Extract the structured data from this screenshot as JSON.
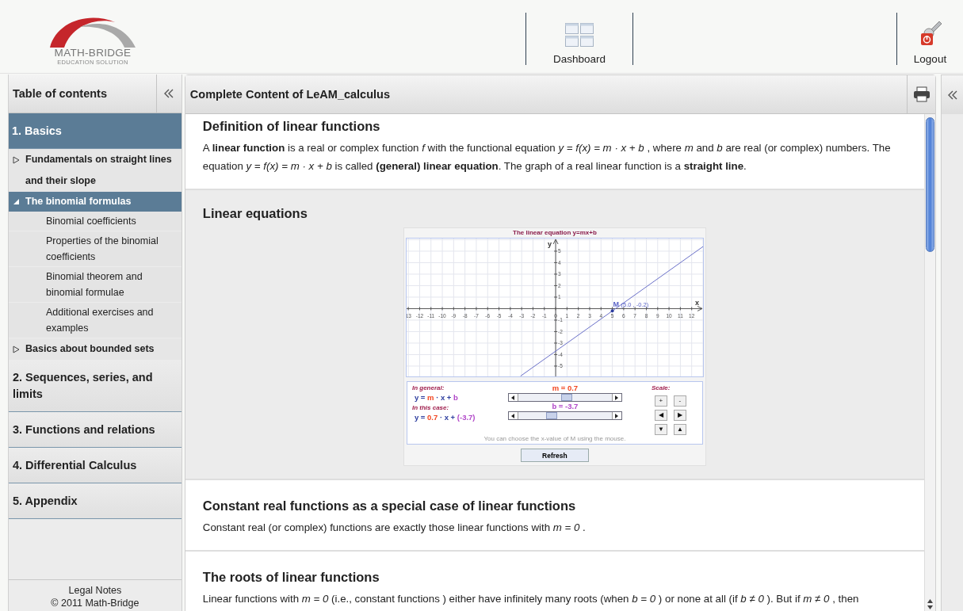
{
  "header": {
    "logo": {
      "name": "MATH-BRIDGE",
      "tagline": "EDUCATION SOLUTION"
    },
    "nav": [
      {
        "label": "Dashboard",
        "kind": "dashboard"
      },
      {
        "label": "Logout",
        "kind": "logout"
      }
    ]
  },
  "sidebar": {
    "title": "Table of contents",
    "toc": [
      {
        "label": "1. Basics",
        "selected": true,
        "children": [
          {
            "label": "Fundamentals on straight lines and their slope",
            "expanded": false,
            "selected": false
          },
          {
            "label": "The binomial formulas",
            "expanded": true,
            "selected": true,
            "children": [
              {
                "label": "Binomial coefficients",
                "selected": false
              },
              {
                "label": "Properties of the binomial coefficients",
                "selected": false
              },
              {
                "label": "Binomial theorem and binomial formulae",
                "selected": false
              },
              {
                "label": "Additional exercises and examples",
                "selected": false
              }
            ]
          },
          {
            "label": "Basics about bounded sets",
            "expanded": false,
            "selected": false
          }
        ]
      },
      {
        "label": "2. Sequences, series, and limits",
        "selected": false
      },
      {
        "label": "3. Functions and relations",
        "selected": false
      },
      {
        "label": "4. Differential Calculus",
        "selected": false
      },
      {
        "label": "5. Appendix",
        "selected": false
      }
    ],
    "footer": [
      "Legal Notes",
      "© 2011 Math-Bridge"
    ]
  },
  "main": {
    "title": "Complete Content of LeAM_calculus",
    "sections": [
      {
        "kind": "text",
        "title": "Definition of linear functions",
        "body": "A **linear function** is a real or complex function *f* with the functional equation *y = f(x) = m · x + b* , where *m* and *b* are real (or complex) numbers. The equation *y = f(x) = m · x + b* is called **(general) linear equation**. The graph of a real linear function is a **straight line**."
      },
      {
        "kind": "applet",
        "title": "Linear equations",
        "chart_data": {
          "type": "line",
          "title": "The linear equation y=mx+b",
          "xlabel": "x",
          "ylabel": "y",
          "x": [
            -3.1,
            13
          ],
          "series": [
            {
              "color": "#6a70c8",
              "values": [
                -5.87,
                5.4
              ]
            }
          ],
          "xlim": [
            -13.15,
            13
          ],
          "ylim": [
            -5.9,
            6.1
          ],
          "xticks": [
            {
              "value": -13,
              "label": "13"
            },
            -12,
            -11,
            -10,
            -9,
            -8,
            -7,
            -6,
            -5,
            -4,
            -3,
            -2,
            -1,
            0,
            1,
            2,
            3,
            4,
            5,
            6,
            7,
            8,
            9,
            10,
            11,
            12
          ],
          "yticks": [
            -5,
            -4,
            -3,
            -2,
            -1,
            1,
            2,
            3,
            4,
            5
          ],
          "grid": true,
          "annotations": [
            {
              "text": "M",
              "x": 5,
              "y": -0.2
            },
            {
              "text": "(5.0 , -0.2)",
              "x": 5,
              "y": -0.2
            }
          ]
        },
        "general_label": "In general:",
        "general_formula": [
          {
            "text": "y =",
            "color": "#2b3c9e"
          },
          {
            "text": "m",
            "color": "#f2451f"
          },
          {
            "text": "· x +",
            "color": "#2b3c9e"
          },
          {
            "text": "b",
            "color": "#b046c8"
          }
        ],
        "case_label": "In this case:",
        "case_formula": [
          {
            "text": "y =",
            "color": "#2b3c9e"
          },
          {
            "text": "0.7",
            "color": "#f2451f"
          },
          {
            "text": "· x +",
            "color": "#2b3c9e"
          },
          {
            "text": "(-3.7)",
            "color": "#b046c8"
          }
        ],
        "sliders": [
          {
            "label": "m = 0.7",
            "color": "#f2451f",
            "level": 0.52
          },
          {
            "label": "b = -3.7",
            "color": "#b046c8",
            "level": 0.36
          }
        ],
        "scale_label": "Scale:",
        "scale_buttons": [
          "+",
          "-",
          "◀",
          "▶",
          "▼",
          "▲"
        ],
        "hint": "You can choose the x-value of M using the mouse.",
        "refresh": "Refresh"
      },
      {
        "kind": "text",
        "title": "Constant real functions as a special case of linear functions",
        "body": "Constant real (or complex) functions are exactly those linear functions with *m = 0* ."
      },
      {
        "kind": "text",
        "title": "The roots of linear functions",
        "body": "Linear functions with *m = 0* (i.e., constant functions ) either have infinitely many roots (when *b = 0* ) or none at all (if *b ≠ 0* ). But if *m ≠ 0* , then"
      }
    ]
  }
}
